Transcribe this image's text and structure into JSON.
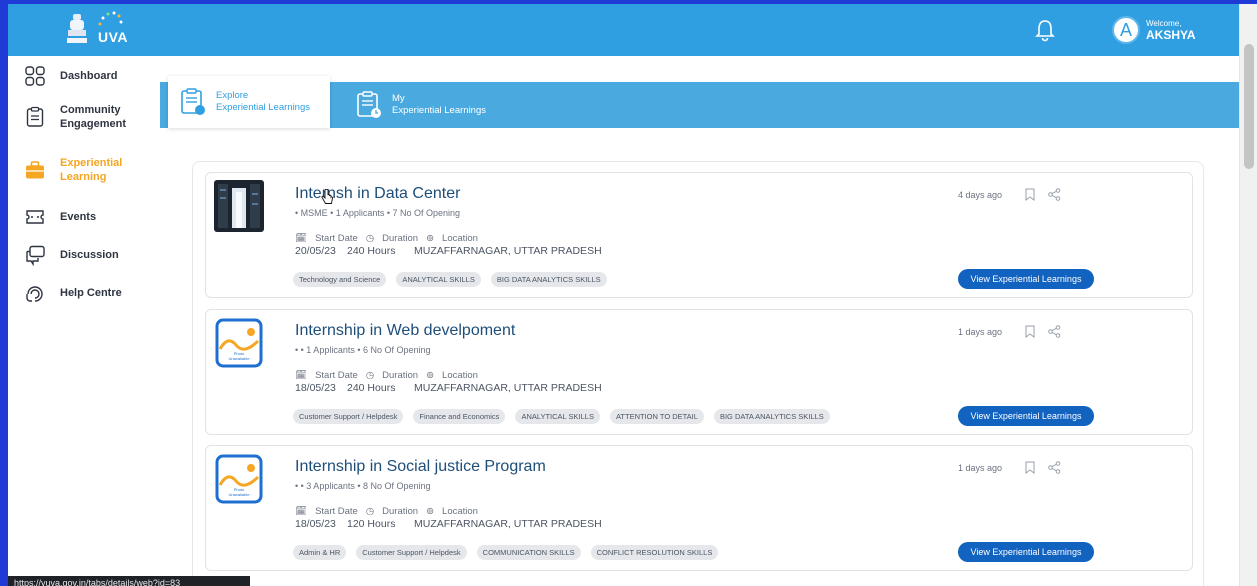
{
  "header": {
    "logo_text": "UVA",
    "welcome_label": "Welcome,",
    "user_name": "AKSHYA",
    "avatar_initial": "A"
  },
  "sidebar": {
    "items": [
      {
        "label": "Dashboard",
        "icon": "dashboard-icon"
      },
      {
        "label": "Community Engagement",
        "icon": "clipboard-icon"
      },
      {
        "label": "Experiential Learning",
        "icon": "briefcase-icon",
        "active": true
      },
      {
        "label": "Events",
        "icon": "events-icon"
      },
      {
        "label": "Discussion",
        "icon": "discussion-icon"
      },
      {
        "label": "Help Centre",
        "icon": "help-icon"
      }
    ]
  },
  "tabs": {
    "explore_line1": "Explore",
    "explore_line2": "Experiential Learnings",
    "mine_line1": "My",
    "mine_line2": "Experiential Learnings"
  },
  "info_labels": {
    "start": "Start Date",
    "duration": "Duration",
    "location": "Location"
  },
  "cards": [
    {
      "title": "Internship in Data Center",
      "title_visible": "Internsh  in Data Center",
      "meta": "• MSME   • 1 Applicants   • 7 No Of Opening",
      "start_date": "20/05/23",
      "duration": "240 Hours",
      "location": "MUZAFFARNAGAR, UTTAR PRADESH",
      "tags": [
        "Technology and Science",
        "ANALYTICAL SKILLS",
        "BIG DATA ANALYTICS SKILLS"
      ],
      "posted": "4 days ago",
      "button": "View Experiential Learnings"
    },
    {
      "title": "Internship in Web develpoment",
      "meta": "•   • 1 Applicants   • 6 No Of Opening",
      "start_date": "18/05/23",
      "duration": "240 Hours",
      "location": "MUZAFFARNAGAR, UTTAR PRADESH",
      "tags": [
        "Customer Support / Helpdesk",
        "Finance and Economics",
        "ANALYTICAL SKILLS",
        "ATTENTION TO DETAIL",
        "BIG DATA ANALYTICS SKILLS"
      ],
      "posted": "1 days ago",
      "button": "View Experiential Learnings",
      "thumb_text": "Photo Unavailable"
    },
    {
      "title": "Internship in Social justice Program",
      "meta": "•   • 3 Applicants   • 8 No Of Opening",
      "start_date": "18/05/23",
      "duration": "120 Hours",
      "location": "MUZAFFARNAGAR, UTTAR PRADESH",
      "tags": [
        "Admin & HR",
        "Customer Support / Helpdesk",
        "COMMUNICATION SKILLS",
        "CONFLICT RESOLUTION SKILLS"
      ],
      "posted": "1 days ago",
      "button": "View Experiential Learnings",
      "thumb_text": "Photo Unavailable"
    }
  ],
  "status_url": "https://yuva.gov.in/tabs/details/web?id=83",
  "colors": {
    "header": "#2f9fe2",
    "tabbar": "#4aa9df",
    "accent_active": "#f5a623",
    "button": "#1262c0"
  }
}
